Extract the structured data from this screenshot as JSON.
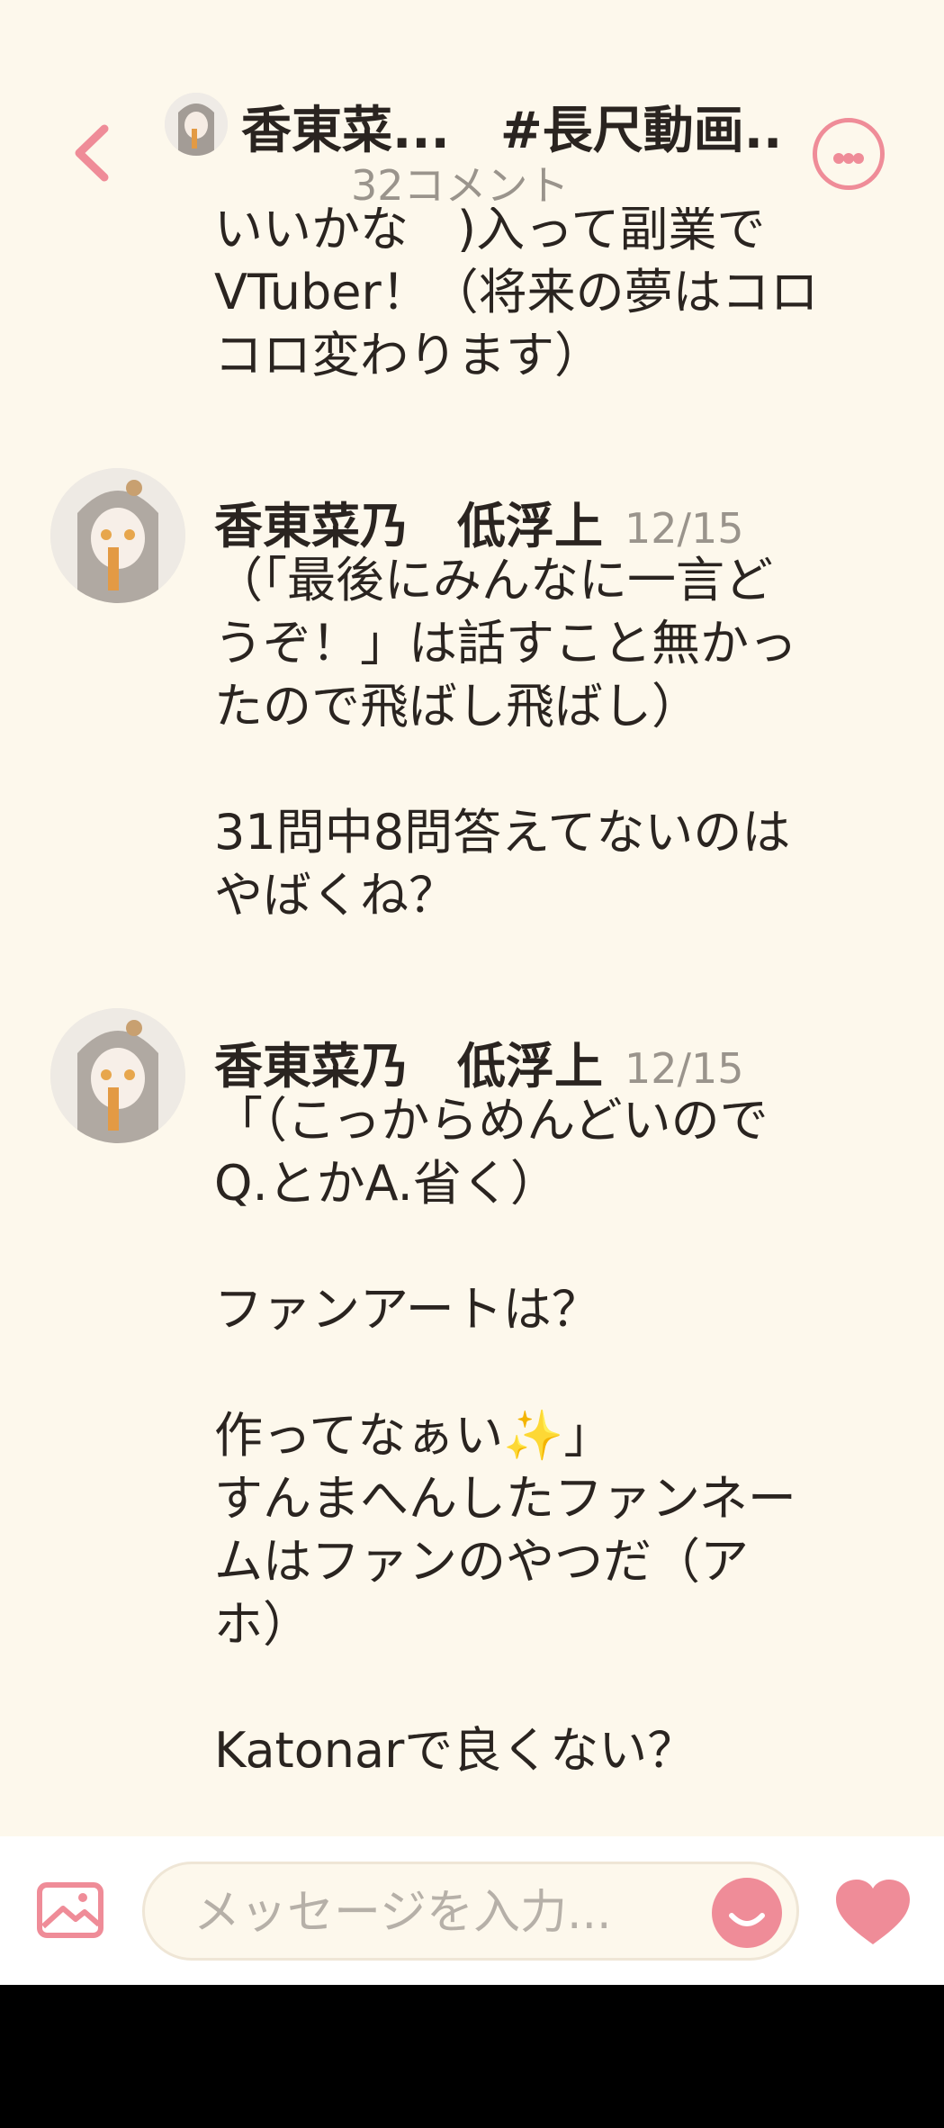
{
  "header": {
    "title": "香東菜...　#長尺動画...",
    "comment_count": "32コメント"
  },
  "partial_comment": {
    "text": "いいかな　)入って副業で\nVTuber！（将来の夢はコロ\nコロ変わります）"
  },
  "comments": [
    {
      "author": "香東菜乃　低浮上",
      "date": "12/15",
      "text": "（「最後にみんなに一言ど\nうぞ！」は話すこと無かっ\nたので飛ばし飛ばし）\n\n31問中8問答えてないのは\nやばくね？"
    },
    {
      "author": "香東菜乃　低浮上",
      "date": "12/15",
      "text": "「（こっからめんどいので\nQ.とかA.省く）\n\nファンアートは？\n\n作ってなぁい✨」\nすんまへんしたファンネー\nムはファンのやつだ（ア\nホ）\n\nKatonarで良くない？"
    }
  ],
  "input": {
    "placeholder": "メッセージを入力..."
  },
  "colors": {
    "accent": "#ef8c98",
    "background": "#fdf8ec",
    "muted_text": "#9a948c"
  },
  "icons": {
    "back": "chevron-left-icon",
    "more": "more-dots-icon",
    "image": "image-icon",
    "emoji": "smiley-icon",
    "like": "heart-icon"
  }
}
